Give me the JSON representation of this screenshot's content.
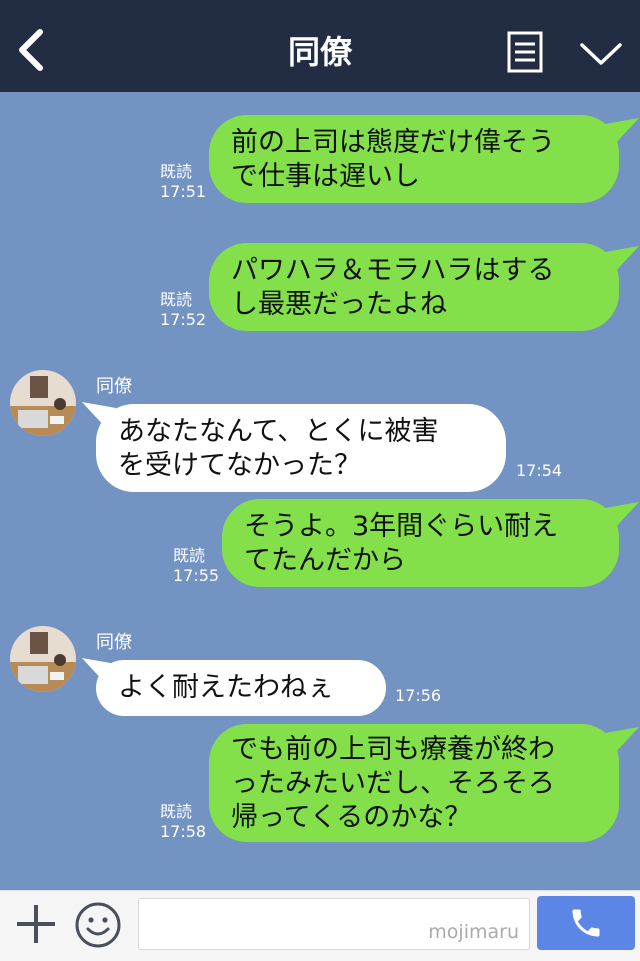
{
  "header": {
    "title": "同僚",
    "back_icon": "chevron-left-icon",
    "menu_icon": "notes-icon",
    "collapse_icon": "chevron-down-icon"
  },
  "messages": [
    {
      "direction": "out",
      "lines": [
        "前の上司は態度だけ偉そう",
        "で仕事は遅いし"
      ],
      "read": "既読",
      "time": "17:51"
    },
    {
      "direction": "out",
      "lines": [
        "パワハラ＆モラハラはする",
        "し最悪だったよね"
      ],
      "read": "既読",
      "time": "17:52"
    },
    {
      "direction": "in",
      "sender": "同僚",
      "lines": [
        "あなたなんて、とくに被害",
        "を受けてなかった？"
      ],
      "time": "17:54"
    },
    {
      "direction": "out",
      "lines": [
        "そうよ。3年間ぐらい耐え",
        "てたんだから"
      ],
      "read": "既読",
      "time": "17:55"
    },
    {
      "direction": "in",
      "sender": "同僚",
      "lines": [
        "よく耐えたわねぇ"
      ],
      "time": "17:56"
    },
    {
      "direction": "out",
      "lines": [
        "でも前の上司も療養が終わ",
        "ったみたいだし、そろそろ",
        "帰ってくるのかな？"
      ],
      "read": "既読",
      "time": "17:58"
    }
  ],
  "footer": {
    "add_icon": "plus-icon",
    "sticker_icon": "smiley-icon",
    "input_value": "",
    "watermark": "mojimaru",
    "call_icon": "phone-icon"
  },
  "colors": {
    "background": "#7393c3",
    "header": "#222c42",
    "outgoing_bubble": "#84e04a",
    "incoming_bubble": "#ffffff",
    "call_button": "#5c86e6"
  }
}
